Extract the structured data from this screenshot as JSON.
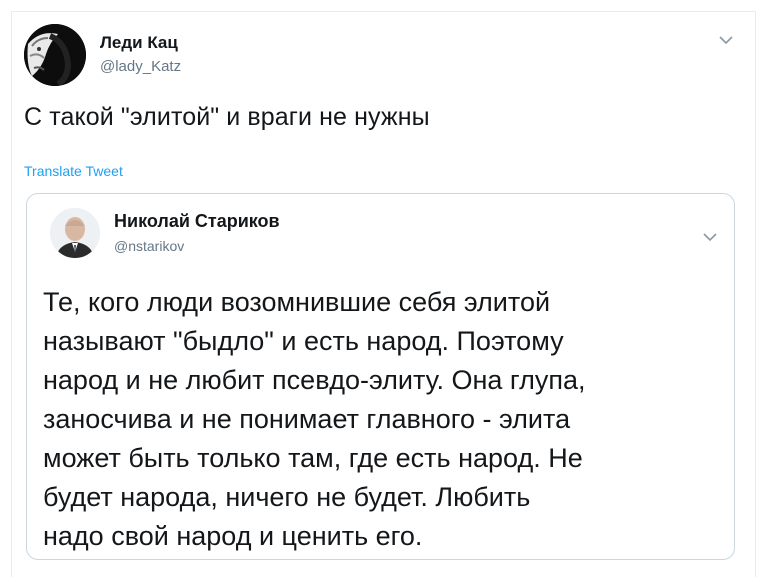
{
  "tweet": {
    "author_name": "Леди Кац",
    "author_handle": "@lady_Katz",
    "text": "С такой \"элитой\" и враги не нужны",
    "translate_label": "Translate Tweet",
    "menu_icon": "chevron-down-icon"
  },
  "quoted_tweet": {
    "author_name": "Николай Стариков",
    "author_handle": "@nstarikov",
    "menu_icon": "chevron-down-icon",
    "text_lines": [
      "Те, кого люди возомнившие себя элитой",
      "называют \"быдло\" и есть народ. Поэтому",
      "народ и не любит псевдо-элиту. Она глупа,",
      "заносчива и не понимает главного - элита",
      "может быть только там, где есть народ. Не",
      "будет народа, ничего не будет. Любить",
      "надо свой народ и ценить его."
    ]
  },
  "colors": {
    "text": "#14171a",
    "secondary": "#657786",
    "link": "#1da1f2",
    "border": "#ccd6dd"
  }
}
